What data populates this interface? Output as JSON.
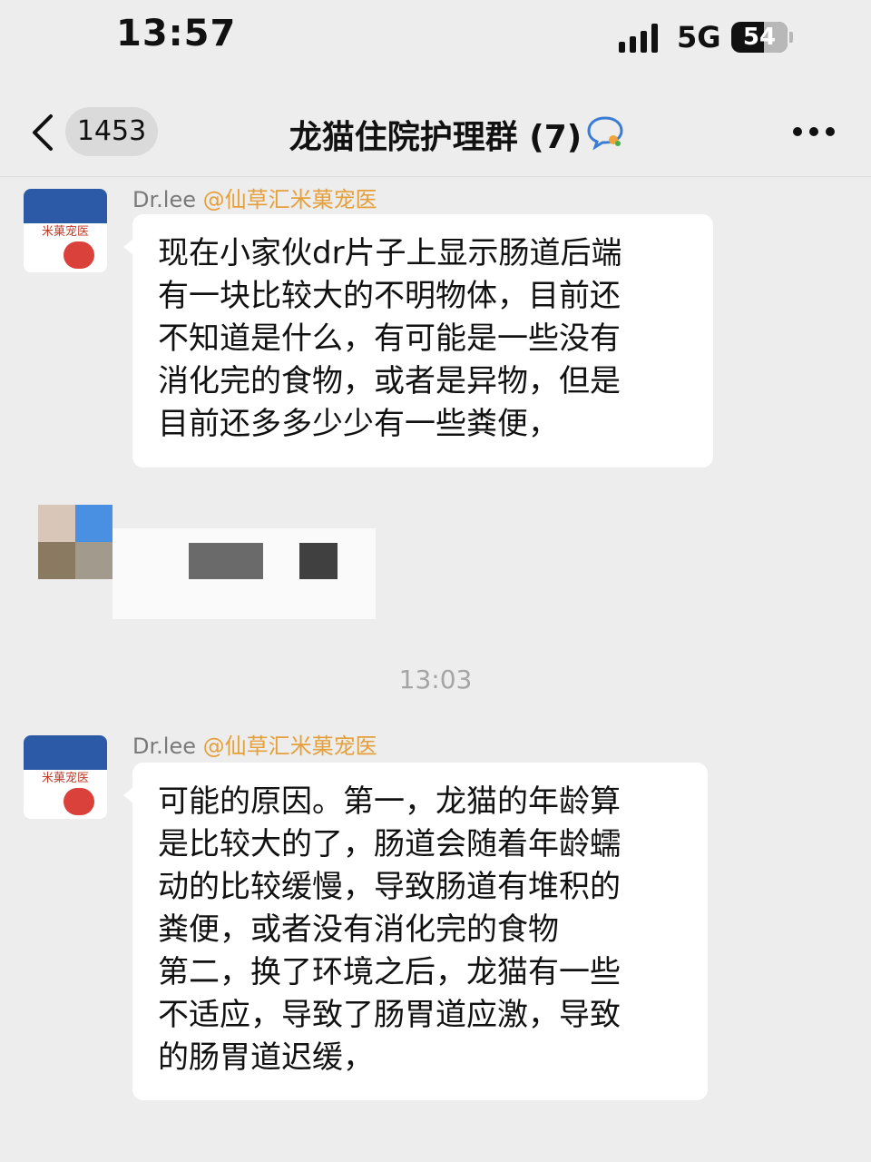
{
  "status_bar": {
    "time": "13:57",
    "network": "5G",
    "battery_level": "54"
  },
  "nav": {
    "unread_count": "1453",
    "title": "龙猫住院护理群 (7)"
  },
  "messages": [
    {
      "sender_name": "Dr.lee",
      "mention": "@仙草汇米菓宠医",
      "avatar_text": "米菓宠医",
      "text": "现在小家伙dr片子上显示肠道后端\n有一块比较大的不明物体，目前还\n不知道是什么，有可能是一些没有\n消化完的食物，或者是异物，但是\n目前还多多少少有一些粪便，"
    },
    {
      "sender_name": "Dr.lee",
      "mention": "@仙草汇米菓宠医",
      "avatar_text": "米菓宠医",
      "text": "可能的原因。第一，龙猫的年龄算\n是比较大的了，肠道会随着年龄蠕\n动的比较缓慢，导致肠道有堆积的\n粪便，或者没有消化完的食物\n第二，换了环境之后，龙猫有一些\n不适应，导致了肠胃道应激，导致\n的肠胃道迟缓，"
    }
  ],
  "time_separators": [
    "13:03"
  ],
  "colors": {
    "background": "#ededed",
    "bubble": "#ffffff",
    "mention": "#e6a03a",
    "avatar_blue": "#2d5aa6",
    "avatar_red": "#d9413a"
  },
  "icons": [
    "back-chevron-icon",
    "chat-bubble-icon",
    "more-dots-icon",
    "signal-icon",
    "battery-icon"
  ]
}
